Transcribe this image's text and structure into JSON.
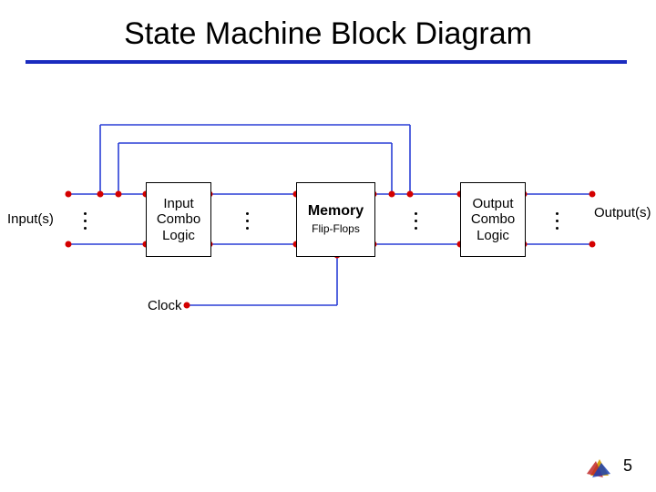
{
  "title": "State Machine Block Diagram",
  "labels": {
    "inputs": "Input(s)",
    "outputs": "Output(s)",
    "clock": "Clock"
  },
  "blocks": {
    "input_combo": {
      "line1": "Input",
      "line2": "Combo",
      "line3": "Logic"
    },
    "memory": {
      "line1": "Memory",
      "line2": "Flip-Flops"
    },
    "output_combo": {
      "line1": "Output",
      "line2": "Combo",
      "line3": "Logic"
    }
  },
  "page_number": "5",
  "colors": {
    "underline": "#1a2bbf",
    "wire_blue": "#2a3fd6",
    "node_red": "#d40000"
  }
}
